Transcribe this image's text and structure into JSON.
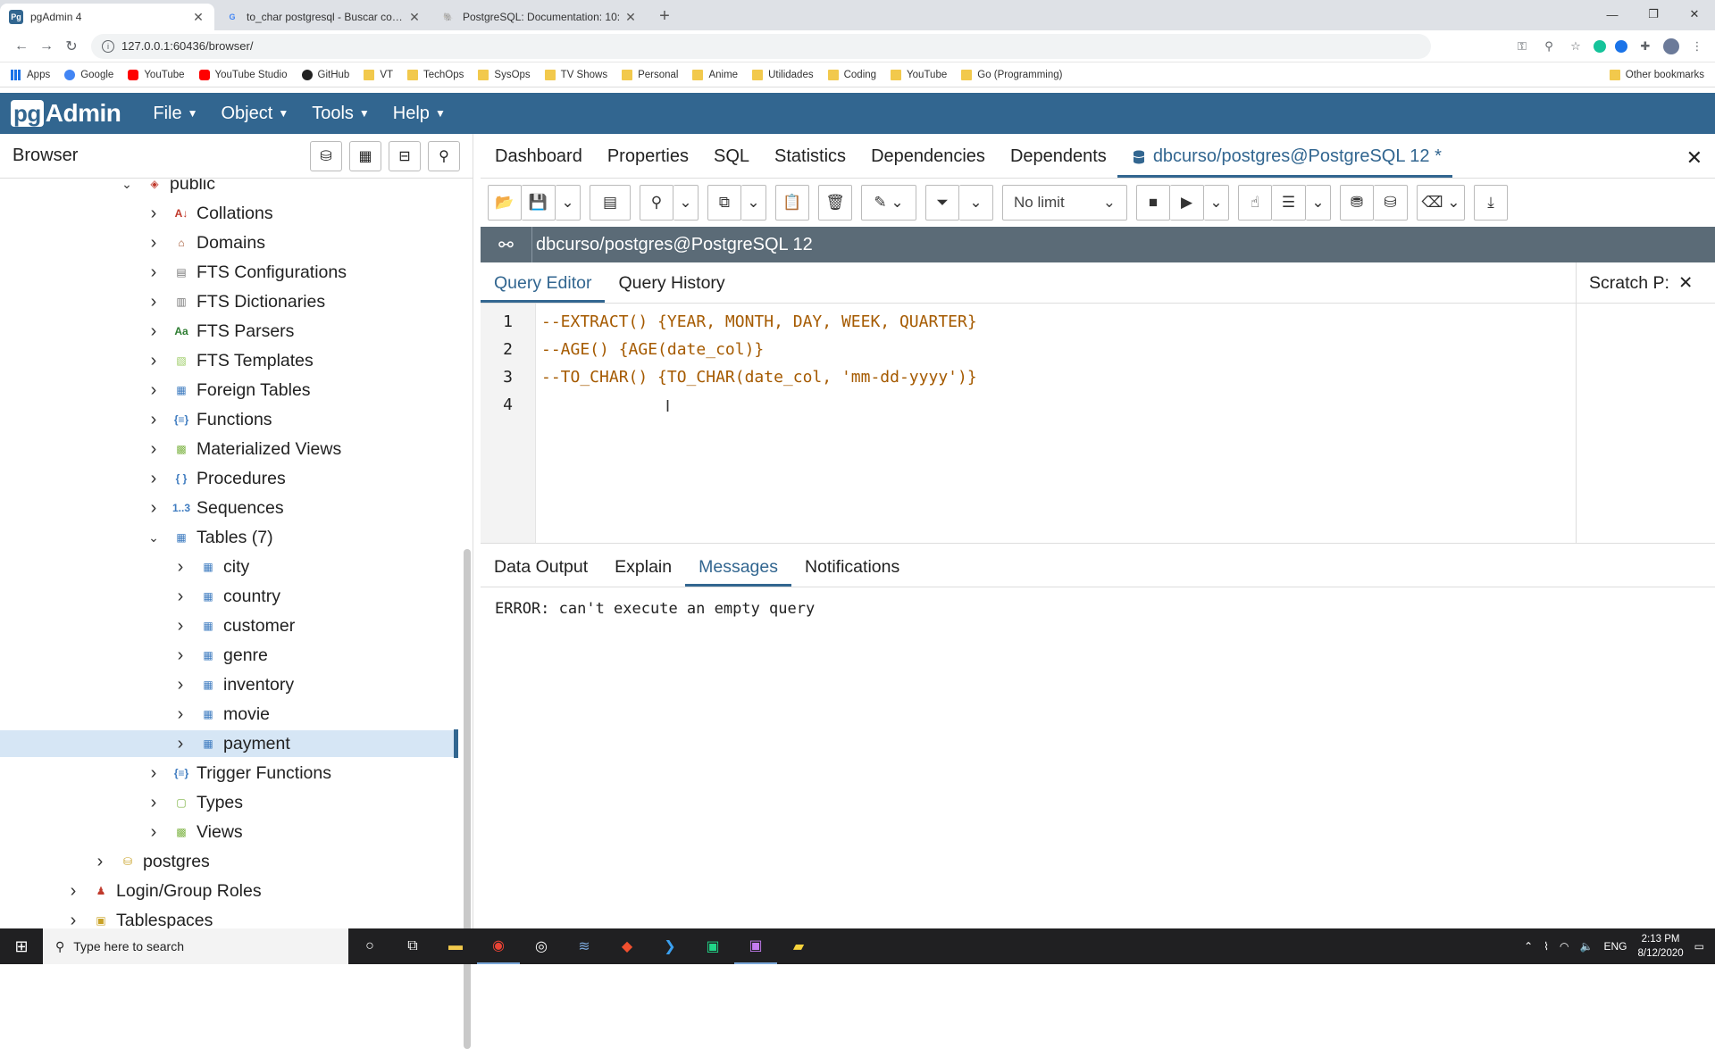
{
  "browser_tabs": [
    {
      "title": "pgAdmin 4",
      "icon": "pgadmin-favicon",
      "active": true
    },
    {
      "title": "to_char postgresql - Buscar con Google",
      "icon": "google-favicon",
      "active": false
    },
    {
      "title": "PostgreSQL: Documentation: 10:",
      "icon": "postgres-favicon",
      "active": false
    }
  ],
  "address": {
    "url": "127.0.0.1:60436/browser/"
  },
  "bookmarks": [
    {
      "label": "Apps",
      "type": "apps"
    },
    {
      "label": "Google",
      "type": "google"
    },
    {
      "label": "YouTube",
      "type": "youtube"
    },
    {
      "label": "YouTube Studio",
      "type": "youtube"
    },
    {
      "label": "GitHub",
      "type": "github"
    },
    {
      "label": "VT",
      "type": "folder"
    },
    {
      "label": "TechOps",
      "type": "folder"
    },
    {
      "label": "SysOps",
      "type": "folder"
    },
    {
      "label": "TV Shows",
      "type": "folder"
    },
    {
      "label": "Personal",
      "type": "folder"
    },
    {
      "label": "Anime",
      "type": "folder"
    },
    {
      "label": "Utilidades",
      "type": "folder"
    },
    {
      "label": "Coding",
      "type": "folder"
    },
    {
      "label": "YouTube",
      "type": "folder"
    },
    {
      "label": "Go (Programming)",
      "type": "folder"
    }
  ],
  "other_bookmarks": "Other bookmarks",
  "app": {
    "logo_pg": "pg",
    "logo_rest": "Admin",
    "menus": [
      "File",
      "Object",
      "Tools",
      "Help"
    ]
  },
  "browser_panel": {
    "title": "Browser",
    "tree": [
      {
        "label": "public",
        "indent": 0,
        "toggle": "open",
        "icon": "schema-icon"
      },
      {
        "label": "Collations",
        "indent": 1,
        "toggle": "closed",
        "icon": "collation-icon"
      },
      {
        "label": "Domains",
        "indent": 1,
        "toggle": "closed",
        "icon": "domain-icon"
      },
      {
        "label": "FTS Configurations",
        "indent": 1,
        "toggle": "closed",
        "icon": "fts-config-icon"
      },
      {
        "label": "FTS Dictionaries",
        "indent": 1,
        "toggle": "closed",
        "icon": "fts-dictionary-icon"
      },
      {
        "label": "FTS Parsers",
        "indent": 1,
        "toggle": "closed",
        "icon": "fts-parser-icon"
      },
      {
        "label": "FTS Templates",
        "indent": 1,
        "toggle": "closed",
        "icon": "fts-template-icon"
      },
      {
        "label": "Foreign Tables",
        "indent": 1,
        "toggle": "closed",
        "icon": "foreign-table-icon"
      },
      {
        "label": "Functions",
        "indent": 1,
        "toggle": "closed",
        "icon": "function-icon"
      },
      {
        "label": "Materialized Views",
        "indent": 1,
        "toggle": "closed",
        "icon": "mview-icon"
      },
      {
        "label": "Procedures",
        "indent": 1,
        "toggle": "closed",
        "icon": "procedure-icon"
      },
      {
        "label": "Sequences",
        "indent": 1,
        "toggle": "closed",
        "icon": "sequence-icon"
      },
      {
        "label": "Tables (7)",
        "indent": 1,
        "toggle": "open",
        "icon": "tables-icon"
      },
      {
        "label": "city",
        "indent": 2,
        "toggle": "closed",
        "icon": "table-icon"
      },
      {
        "label": "country",
        "indent": 2,
        "toggle": "closed",
        "icon": "table-icon"
      },
      {
        "label": "customer",
        "indent": 2,
        "toggle": "closed",
        "icon": "table-icon"
      },
      {
        "label": "genre",
        "indent": 2,
        "toggle": "closed",
        "icon": "table-icon"
      },
      {
        "label": "inventory",
        "indent": 2,
        "toggle": "closed",
        "icon": "table-icon"
      },
      {
        "label": "movie",
        "indent": 2,
        "toggle": "closed",
        "icon": "table-icon"
      },
      {
        "label": "payment",
        "indent": 2,
        "toggle": "closed",
        "icon": "table-icon",
        "selected": true
      },
      {
        "label": "Trigger Functions",
        "indent": 1,
        "toggle": "closed",
        "icon": "trigger-function-icon"
      },
      {
        "label": "Types",
        "indent": 1,
        "toggle": "closed",
        "icon": "type-icon"
      },
      {
        "label": "Views",
        "indent": 1,
        "toggle": "closed",
        "icon": "view-icon"
      },
      {
        "label": "postgres",
        "indent": -1,
        "toggle": "closed",
        "icon": "database-icon"
      },
      {
        "label": "Login/Group Roles",
        "indent": -2,
        "toggle": "closed",
        "icon": "roles-icon"
      },
      {
        "label": "Tablespaces",
        "indent": -2,
        "toggle": "closed",
        "icon": "tablespace-icon"
      }
    ]
  },
  "main_tabs": [
    "Dashboard",
    "Properties",
    "SQL",
    "Statistics",
    "Dependencies",
    "Dependents"
  ],
  "active_main_tab": "dbcurso/postgres@PostgreSQL 12 *",
  "toolbar": {
    "limit": "No limit"
  },
  "connection": {
    "label": "dbcurso/postgres@PostgreSQL 12"
  },
  "editor_tabs": [
    "Query Editor",
    "Query History"
  ],
  "scratch_pad": {
    "label": "Scratch P:"
  },
  "editor": {
    "line_numbers": [
      "1",
      "2",
      "3",
      "4"
    ],
    "lines": [
      "--EXTRACT() {YEAR, MONTH, DAY, WEEK, QUARTER}",
      "--AGE() {AGE(date_col)}",
      "--TO_CHAR() {TO_CHAR(date_col, 'mm-dd-yyyy')}",
      ""
    ]
  },
  "output_tabs": [
    "Data Output",
    "Explain",
    "Messages",
    "Notifications"
  ],
  "output": {
    "message": "ERROR: can't execute an empty query"
  },
  "taskbar": {
    "search_placeholder": "Type here to search",
    "tray_lang": "ENG",
    "time": "2:13 PM",
    "date": "8/12/2020"
  },
  "colors": {
    "pg_blue": "#326690",
    "code_orange": "#a55a00",
    "conn_bar": "#5b6b77"
  }
}
